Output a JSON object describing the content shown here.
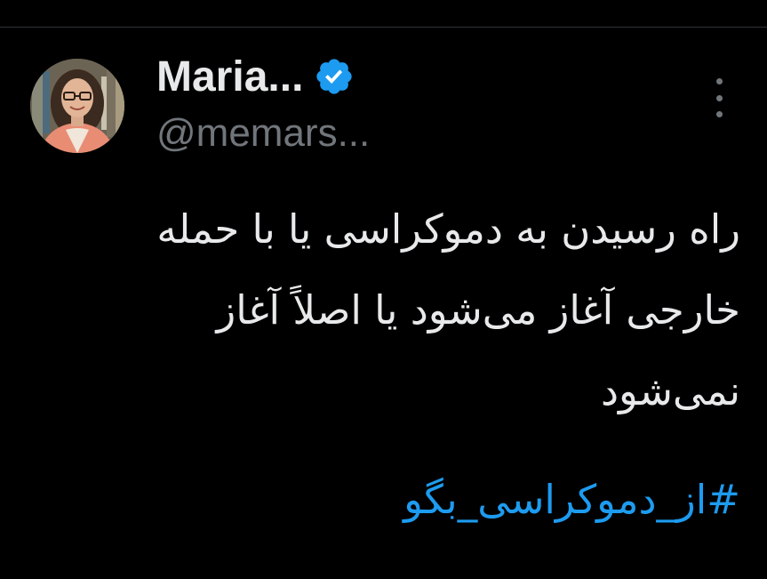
{
  "tweet": {
    "author": {
      "display_name": "Maria...",
      "handle": "@memars...",
      "verified": true,
      "avatar_icon": "profile-photo"
    },
    "text": "راه رسیدن به دموکراسی یا با حمله خارجی آغاز می‌شود یا اصلاً آغاز نمی‌شود",
    "hashtag": "#از_دموکراسی_بگو",
    "more_icon": "ellipsis-vertical-icon"
  },
  "colors": {
    "background": "#000000",
    "text_primary": "#e7e9ea",
    "text_secondary": "#71767b",
    "accent": "#1d9bf0",
    "divider": "#2f3336"
  }
}
